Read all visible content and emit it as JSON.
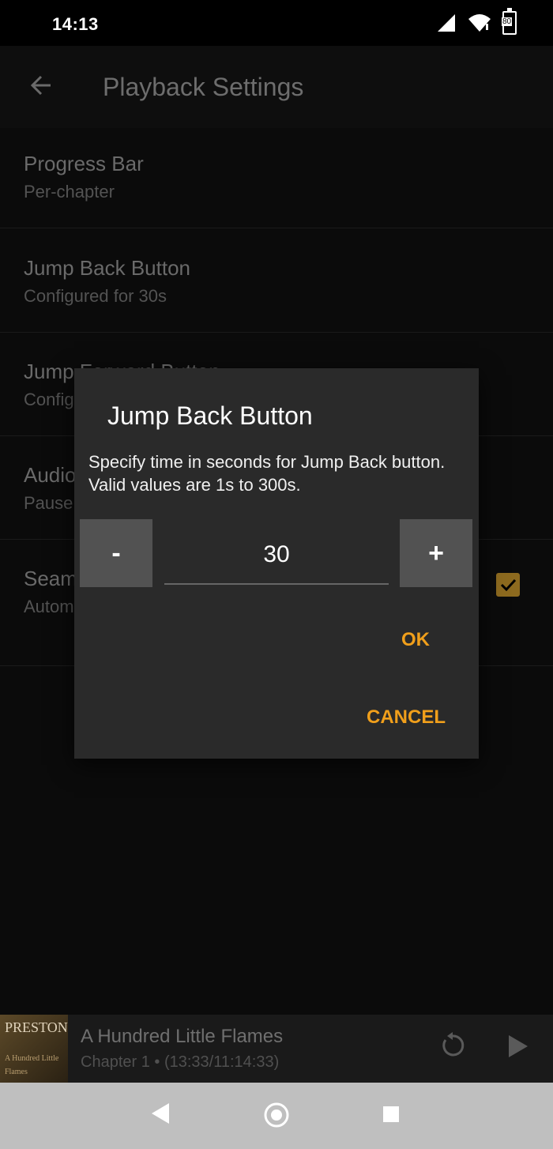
{
  "status": {
    "time": "14:13",
    "battery": "80"
  },
  "appbar": {
    "title": "Playback Settings"
  },
  "settings": [
    {
      "title": "Progress Bar",
      "subtitle": "Per-chapter"
    },
    {
      "title": "Jump Back Button",
      "subtitle": "Configured for 30s"
    },
    {
      "title": "Jump Forward Button",
      "subtitle": "Configured for 30s"
    },
    {
      "title": "Audio",
      "subtitle": "Pause"
    },
    {
      "title": "Seamless",
      "subtitle": "Autom... segme..."
    }
  ],
  "dialog": {
    "title": "Jump Back Button",
    "message": "Specify time in seconds for Jump Back button. Valid values are 1s to 300s.",
    "decrement_label": "-",
    "increment_label": "+",
    "value": "30",
    "ok_label": "OK",
    "cancel_label": "CANCEL"
  },
  "player": {
    "title": "A Hundred Little Flames",
    "subtitle": "Chapter 1 • (13:33/11:14:33)",
    "cover_text": "PRESTON",
    "cover_subtext": "A Hundred Little Flames"
  }
}
